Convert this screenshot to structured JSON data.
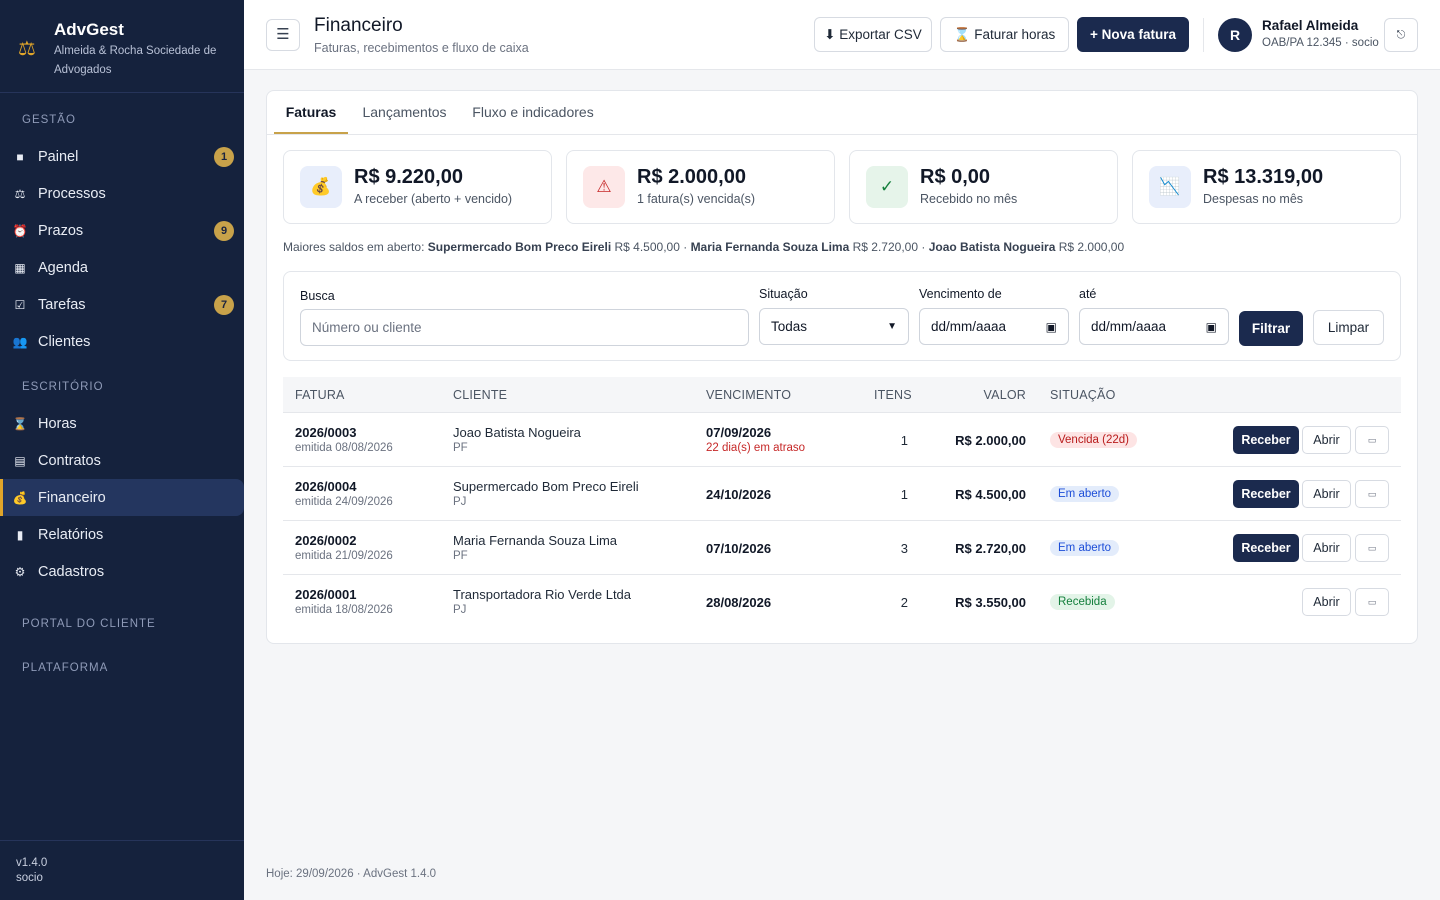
{
  "brand": {
    "name": "AdvGest",
    "subtitle": "Almeida & Rocha Sociedade de Advogados",
    "logo_icon": "scales-icon"
  },
  "sidebar": {
    "sections": [
      "GESTÃO",
      "ESCRITÓRIO",
      "PORTAL DO CLIENTE",
      "PLATAFORMA"
    ],
    "gestao": [
      {
        "label": "Painel",
        "icon": "■",
        "badge": "1"
      },
      {
        "label": "Processos",
        "icon": "⚖",
        "badge": ""
      },
      {
        "label": "Prazos",
        "icon": "⏰",
        "badge": "9"
      },
      {
        "label": "Agenda",
        "icon": "▦",
        "badge": ""
      },
      {
        "label": "Tarefas",
        "icon": "☑",
        "badge": "7"
      },
      {
        "label": "Clientes",
        "icon": "👥",
        "badge": ""
      }
    ],
    "escritorio": [
      {
        "label": "Horas",
        "icon": "⌛"
      },
      {
        "label": "Contratos",
        "icon": "▤"
      },
      {
        "label": "Financeiro",
        "icon": "💰"
      },
      {
        "label": "Relatórios",
        "icon": "▮"
      },
      {
        "label": "Cadastros",
        "icon": "⚙"
      }
    ],
    "version": "v1.4.0",
    "role": "socio"
  },
  "header": {
    "menu_icon": "☰",
    "title": "Financeiro",
    "subtitle": "Faturas, recebimentos e fluxo de caixa",
    "export_label": "⬇ Exportar CSV",
    "bill_hours_label": "⌛ Faturar horas",
    "new_invoice_label": "+ Nova fatura",
    "user_initial": "R",
    "user_name": "Rafael Almeida",
    "user_role": "OAB/PA 12.345 · socio",
    "logout_icon": "⎋"
  },
  "tabs": [
    "Faturas",
    "Lançamentos",
    "Fluxo e indicadores"
  ],
  "kpis": [
    {
      "value": "R$ 9.220,00",
      "label": "A receber (aberto + vencido)",
      "icon": "💰",
      "color": "#e8eefb"
    },
    {
      "value": "R$ 2.000,00",
      "label": "1 fatura(s) vencida(s)",
      "icon": "⚠",
      "color": "#fde8e8"
    },
    {
      "value": "R$ 0,00",
      "label": "Recebido no mês",
      "icon": "✓",
      "color": "#e6f4ea"
    },
    {
      "value": "R$ 13.319,00",
      "label": "Despesas no mês",
      "icon": "📉",
      "color": "#e8eefb"
    }
  ],
  "balances": {
    "prefix": "Maiores saldos em aberto:",
    "items": [
      {
        "name": "Supermercado Bom Preco Eireli",
        "amount": "R$ 4.500,00"
      },
      {
        "name": "Maria Fernanda Souza Lima",
        "amount": "R$ 2.720,00"
      },
      {
        "name": "Joao Batista Nogueira",
        "amount": "R$ 2.000,00"
      }
    ]
  },
  "filters": {
    "search_label": "Busca",
    "search_placeholder": "Número ou cliente",
    "status_label": "Situação",
    "status_value": "Todas",
    "due_from_label": "Vencimento de",
    "due_to_label": "até",
    "date_placeholder": "dd/mm/aaaa",
    "filter_button": "Filtrar",
    "clear_button": "Limpar"
  },
  "table": {
    "headers": [
      "FATURA",
      "CLIENTE",
      "VENCIMENTO",
      "ITENS",
      "VALOR",
      "SITUAÇÃO"
    ],
    "receive_label": "Receber",
    "open_label": "Abrir",
    "rows": [
      {
        "number": "2026/0003",
        "issued": "emitida 08/08/2026",
        "client": "Joao Batista Nogueira",
        "type": "PF",
        "due": "07/09/2026",
        "late": "22 dia(s) em atraso",
        "items": "1",
        "value": "R$ 2.000,00",
        "status": "Vencida (22d)",
        "status_kind": "red",
        "can_receive": true
      },
      {
        "number": "2026/0004",
        "issued": "emitida 24/09/2026",
        "client": "Supermercado Bom Preco Eireli",
        "type": "PJ",
        "due": "24/10/2026",
        "late": "",
        "items": "1",
        "value": "R$ 4.500,00",
        "status": "Em aberto",
        "status_kind": "blue",
        "can_receive": true
      },
      {
        "number": "2026/0002",
        "issued": "emitida 21/09/2026",
        "client": "Maria Fernanda Souza Lima",
        "type": "PF",
        "due": "07/10/2026",
        "late": "",
        "items": "3",
        "value": "R$ 2.720,00",
        "status": "Em aberto",
        "status_kind": "blue",
        "can_receive": true
      },
      {
        "number": "2026/0001",
        "issued": "emitida 18/08/2026",
        "client": "Transportadora Rio Verde Ltda",
        "type": "PJ",
        "due": "28/08/2026",
        "late": "",
        "items": "2",
        "value": "R$ 3.550,00",
        "status": "Recebida",
        "status_kind": "green",
        "can_receive": false
      }
    ]
  },
  "footer": "Hoje: 29/09/2026 · AdvGest 1.4.0"
}
